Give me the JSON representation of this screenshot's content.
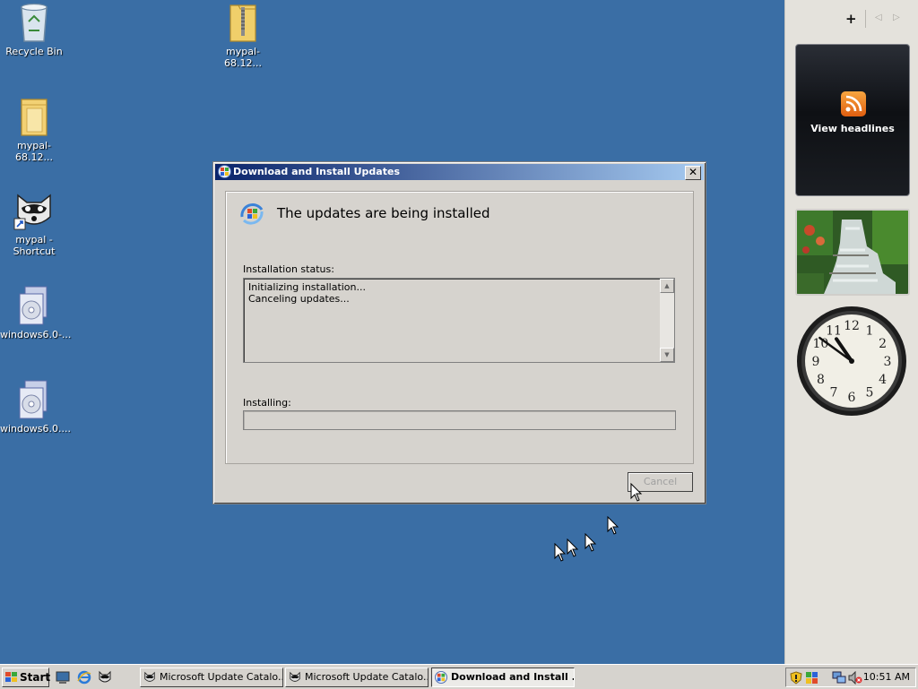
{
  "desktop": {
    "icons": [
      {
        "label": "Recycle Bin",
        "icon": "recycle-bin-icon"
      },
      {
        "label": "mypal-68.12...",
        "icon": "zip-folder-icon"
      },
      {
        "label": "mypal-68.12...",
        "icon": "folder-icon"
      },
      {
        "label": "mypal - Shortcut",
        "icon": "raccoon-icon"
      },
      {
        "label": "windows6.0-...",
        "icon": "installer-package-icon"
      },
      {
        "label": "windows6.0....",
        "icon": "installer-package-icon"
      }
    ]
  },
  "sidebar": {
    "add_gadget": "+",
    "prev": "◁",
    "next": "▷",
    "feed_label": "View headlines",
    "clock_numbers": [
      "12",
      "1",
      "2",
      "3",
      "4",
      "5",
      "6",
      "7",
      "8",
      "9",
      "10",
      "11"
    ],
    "clock_time": "10:51"
  },
  "dialog": {
    "title": "Download and Install Updates",
    "close": "✕",
    "heading": "The updates are being installed",
    "status_label": "Installation status:",
    "status_lines": [
      "Initializing installation...",
      "Canceling updates..."
    ],
    "progress_label": "Installing:",
    "progress_fraction": 0,
    "cancel_label": "Cancel"
  },
  "taskbar": {
    "start_label": "Start",
    "quick_launch": [
      "show-desktop-icon",
      "internet-explorer-icon",
      "raccoon-icon"
    ],
    "buttons": [
      {
        "label": "Microsoft Update Catalo...",
        "active": false
      },
      {
        "label": "Microsoft Update Catalo...",
        "active": false
      },
      {
        "label": "Download and Install ...",
        "active": true
      }
    ],
    "tray_icons": [
      "security-shield-icon",
      "windows-update-icon",
      "network-icon",
      "volume-muted-icon"
    ],
    "clock": "10:51 AM"
  }
}
